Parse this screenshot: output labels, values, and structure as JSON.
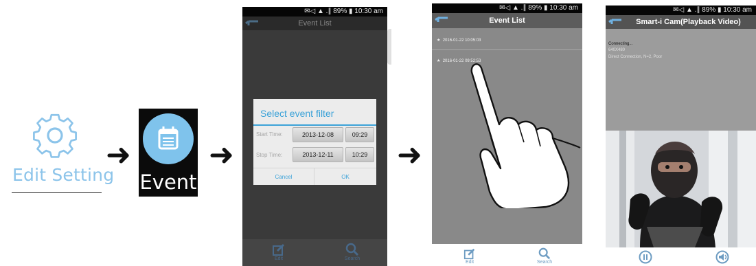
{
  "step1": {
    "label": "Edit Setting",
    "icon": "gear-icon",
    "color": "#8cc4ea"
  },
  "step2": {
    "label": "Event",
    "icon": "calendar-icon",
    "color": "#7fc3ec"
  },
  "phone3": {
    "status": "✉◁ ▲ .∥ 89% ▮ 10:30 am",
    "title": "Event List",
    "dialog": {
      "title": "Select event filter",
      "start_label": "Start Time:",
      "start_date": "2013-12-08",
      "start_time": "09:29",
      "stop_label": "Stop Time:",
      "stop_date": "2013-12-11",
      "stop_time": "10:29",
      "cancel": "Cancel",
      "ok": "OK"
    },
    "toolbar": {
      "edit": "Edit",
      "search": "Search"
    }
  },
  "phone4": {
    "status": "✉◁ ▲ .∥ 89% ▮ 10:30 am",
    "title": "Event List",
    "events": [
      "2016-01-22 10:05:03",
      "2016-01-22 09:52:53"
    ],
    "toolbar": {
      "edit": "Edit",
      "search": "Search"
    }
  },
  "phone5": {
    "status": "✉◁ ▲ .∥ 89% ▮ 10:30 am",
    "title": "Smart-i Cam(Playback Video)",
    "connecting": "Connecting...",
    "resolution": "640X480",
    "connection_info": "Direct Connection, N=2, Poor",
    "controls": [
      "pause-icon",
      "speaker-icon"
    ]
  }
}
